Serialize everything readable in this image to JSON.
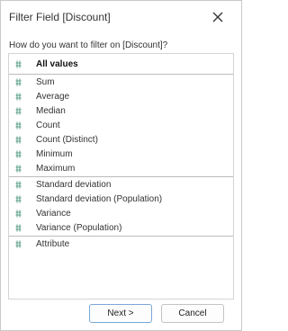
{
  "dialog": {
    "title": "Filter Field [Discount]",
    "prompt": "How do you want to filter on [Discount]?"
  },
  "options": [
    {
      "label": "All values",
      "selected": true,
      "icon": "measure-hash-icon"
    },
    {
      "label": "Sum",
      "icon": "measure-hash-icon"
    },
    {
      "label": "Average",
      "icon": "measure-hash-icon"
    },
    {
      "label": "Median",
      "icon": "measure-hash-icon"
    },
    {
      "label": "Count",
      "icon": "measure-hash-icon"
    },
    {
      "label": "Count (Distinct)",
      "icon": "measure-hash-icon"
    },
    {
      "label": "Minimum",
      "icon": "measure-hash-icon"
    },
    {
      "label": "Maximum",
      "icon": "measure-hash-icon"
    },
    {
      "label": "Standard deviation",
      "icon": "measure-hash-icon"
    },
    {
      "label": "Standard deviation (Population)",
      "icon": "measure-hash-icon"
    },
    {
      "label": "Variance",
      "icon": "measure-hash-icon"
    },
    {
      "label": "Variance (Population)",
      "icon": "measure-hash-icon"
    },
    {
      "label": "Attribute",
      "icon": "measure-hash-icon"
    }
  ],
  "buttons": {
    "next_label": "Next >",
    "cancel_label": "Cancel"
  },
  "colors": {
    "hash_icon": "#5a9e86",
    "separator": "#bcbcbc",
    "default_button_border": "#7aa7d6"
  }
}
